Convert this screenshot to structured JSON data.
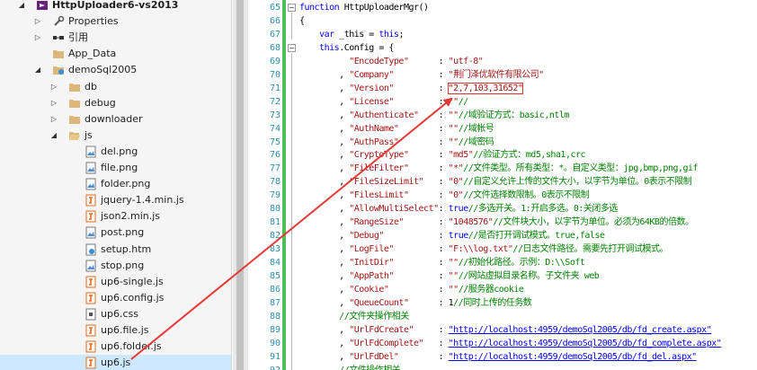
{
  "tree": [
    {
      "label": "HttpUploader6-vs2013",
      "depth": 0,
      "arrow": "expanded",
      "icon": "solution-icon",
      "bold": true
    },
    {
      "label": "Properties",
      "depth": 1,
      "arrow": "collapsed",
      "icon": "wrench-icon"
    },
    {
      "label": "引用",
      "depth": 1,
      "arrow": "collapsed",
      "icon": "references-icon"
    },
    {
      "label": "App_Data",
      "depth": 1,
      "arrow": "none",
      "icon": "folder-icon"
    },
    {
      "label": "demoSql2005",
      "depth": 1,
      "arrow": "expanded",
      "icon": "web-folder-icon"
    },
    {
      "label": "db",
      "depth": 2,
      "arrow": "collapsed",
      "icon": "folder-icon"
    },
    {
      "label": "debug",
      "depth": 2,
      "arrow": "collapsed",
      "icon": "folder-icon"
    },
    {
      "label": "downloader",
      "depth": 2,
      "arrow": "collapsed",
      "icon": "folder-icon"
    },
    {
      "label": "js",
      "depth": 2,
      "arrow": "expanded",
      "icon": "folder-open-icon"
    },
    {
      "label": "del.png",
      "depth": 3,
      "arrow": "none",
      "icon": "image-file-icon"
    },
    {
      "label": "file.png",
      "depth": 3,
      "arrow": "none",
      "icon": "image-file-icon"
    },
    {
      "label": "folder.png",
      "depth": 3,
      "arrow": "none",
      "icon": "image-file-icon"
    },
    {
      "label": "jquery-1.4.min.js",
      "depth": 3,
      "arrow": "none",
      "icon": "js-file-icon"
    },
    {
      "label": "json2.min.js",
      "depth": 3,
      "arrow": "none",
      "icon": "js-file-icon"
    },
    {
      "label": "post.png",
      "depth": 3,
      "arrow": "none",
      "icon": "image-file-icon"
    },
    {
      "label": "setup.htm",
      "depth": 3,
      "arrow": "none",
      "icon": "html-file-icon"
    },
    {
      "label": "stop.png",
      "depth": 3,
      "arrow": "none",
      "icon": "image-file-icon"
    },
    {
      "label": "up6-single.js",
      "depth": 3,
      "arrow": "none",
      "icon": "js-file-icon"
    },
    {
      "label": "up6.config.js",
      "depth": 3,
      "arrow": "none",
      "icon": "js-file-icon"
    },
    {
      "label": "up6.css",
      "depth": 3,
      "arrow": "none",
      "icon": "css-file-icon"
    },
    {
      "label": "up6.file.js",
      "depth": 3,
      "arrow": "none",
      "icon": "js-file-icon"
    },
    {
      "label": "up6.folder.js",
      "depth": 3,
      "arrow": "none",
      "icon": "js-file-icon"
    },
    {
      "label": "up6.js",
      "depth": 3,
      "arrow": "none",
      "icon": "js-file-icon",
      "selected": true
    }
  ],
  "code": [
    {
      "n": "65",
      "fold": "minus",
      "toks": [
        [
          "kw",
          "function"
        ],
        [
          "p",
          " HttpUploaderMgr()"
        ]
      ]
    },
    {
      "n": "66",
      "toks": [
        [
          "p",
          "{"
        ]
      ]
    },
    {
      "n": "67",
      "toks": [
        [
          "p",
          "    "
        ],
        [
          "kw",
          "var"
        ],
        [
          "p",
          " _this = "
        ],
        [
          "kw",
          "this"
        ],
        [
          "p",
          ";"
        ]
      ]
    },
    {
      "n": "68",
      "fold": "minus",
      "toks": [
        [
          "p",
          "    "
        ],
        [
          "kw",
          "this"
        ],
        [
          "p",
          ".Config = {"
        ]
      ]
    },
    {
      "n": "69",
      "toks": [
        [
          "p",
          "          "
        ],
        [
          "str",
          "\"EncodeType\""
        ],
        [
          "p",
          "      : "
        ],
        [
          "str",
          "\"utf-8\""
        ]
      ]
    },
    {
      "n": "70",
      "toks": [
        [
          "p",
          "        , "
        ],
        [
          "str",
          "\"Company\""
        ],
        [
          "p",
          "         : "
        ],
        [
          "str",
          "\"荆门泽优软件有限公司\""
        ]
      ]
    },
    {
      "n": "71",
      "toks": [
        [
          "p",
          "        , "
        ],
        [
          "str",
          "\"Version\""
        ],
        [
          "p",
          "         : "
        ],
        [
          "str",
          "\"2,7,103,31652\"",
          "hl"
        ]
      ]
    },
    {
      "n": "72",
      "toks": [
        [
          "p",
          "        , "
        ],
        [
          "str",
          "\"License\""
        ],
        [
          "p",
          "         : "
        ],
        [
          "str",
          "\"\""
        ],
        [
          "cmt",
          "//"
        ]
      ]
    },
    {
      "n": "73",
      "toks": [
        [
          "p",
          "        , "
        ],
        [
          "str",
          "\"Authenticate\""
        ],
        [
          "p",
          "    : "
        ],
        [
          "str",
          "\"\""
        ],
        [
          "cmt",
          "//域验证方式：basic,ntlm"
        ]
      ]
    },
    {
      "n": "74",
      "toks": [
        [
          "p",
          "        , "
        ],
        [
          "str",
          "\"AuthName\""
        ],
        [
          "p",
          "        : "
        ],
        [
          "str",
          "\"\""
        ],
        [
          "cmt",
          "//域帐号"
        ]
      ]
    },
    {
      "n": "75",
      "toks": [
        [
          "p",
          "        , "
        ],
        [
          "str",
          "\"AuthPass\""
        ],
        [
          "p",
          "        : "
        ],
        [
          "str",
          "\"\""
        ],
        [
          "cmt",
          "//域密码"
        ]
      ]
    },
    {
      "n": "76",
      "toks": [
        [
          "p",
          "        , "
        ],
        [
          "str",
          "\"CryptoType\""
        ],
        [
          "p",
          "      : "
        ],
        [
          "str",
          "\"md5\""
        ],
        [
          "cmt",
          "//验证方式：md5,sha1,crc"
        ]
      ]
    },
    {
      "n": "77",
      "toks": [
        [
          "p",
          "        , "
        ],
        [
          "str",
          "\"FileFilter\""
        ],
        [
          "p",
          "      : "
        ],
        [
          "str",
          "\"*\""
        ],
        [
          "cmt",
          "//文件类型。所有类型：*。自定义类型：jpg,bmp,png,gif"
        ]
      ]
    },
    {
      "n": "78",
      "toks": [
        [
          "p",
          "        , "
        ],
        [
          "str",
          "\"FileSizeLimit\""
        ],
        [
          "p",
          "   : "
        ],
        [
          "str",
          "\"0\""
        ],
        [
          "cmt",
          "//自定义允许上传的文件大小，以字节为单位。0表示不限制"
        ]
      ]
    },
    {
      "n": "79",
      "toks": [
        [
          "p",
          "        , "
        ],
        [
          "str",
          "\"FilesLimit\""
        ],
        [
          "p",
          "      : "
        ],
        [
          "str",
          "\"0\""
        ],
        [
          "cmt",
          "//文件选择数限制。0表示不限制"
        ]
      ]
    },
    {
      "n": "80",
      "toks": [
        [
          "p",
          "        , "
        ],
        [
          "str",
          "\"AllowMultiSelect\""
        ],
        [
          "p",
          ": "
        ],
        [
          "kw",
          "true"
        ],
        [
          "cmt",
          "//多选开关。1:开启多选。0:关闭多选"
        ]
      ]
    },
    {
      "n": "81",
      "toks": [
        [
          "p",
          "        , "
        ],
        [
          "str",
          "\"RangeSize\""
        ],
        [
          "p",
          "       : "
        ],
        [
          "str",
          "\"1048576\""
        ],
        [
          "cmt",
          "//文件块大小，以字节为单位。必须为64KB的倍数。"
        ]
      ]
    },
    {
      "n": "82",
      "toks": [
        [
          "p",
          "        , "
        ],
        [
          "str",
          "\"Debug\""
        ],
        [
          "p",
          "           : "
        ],
        [
          "kw",
          "true"
        ],
        [
          "cmt",
          "//是否打开调试模式。true,false"
        ]
      ]
    },
    {
      "n": "83",
      "toks": [
        [
          "p",
          "        , "
        ],
        [
          "str",
          "\"LogFile\""
        ],
        [
          "p",
          "         : "
        ],
        [
          "str",
          "\"F:\\\\log.txt\""
        ],
        [
          "cmt",
          "//日志文件路径。需要先打开调试模式。"
        ]
      ]
    },
    {
      "n": "84",
      "toks": [
        [
          "p",
          "        , "
        ],
        [
          "str",
          "\"InitDir\""
        ],
        [
          "p",
          "         : "
        ],
        [
          "str",
          "\"\""
        ],
        [
          "cmt",
          "//初始化路径。示例：D:\\\\Soft"
        ]
      ]
    },
    {
      "n": "85",
      "toks": [
        [
          "p",
          "        , "
        ],
        [
          "str",
          "\"AppPath\""
        ],
        [
          "p",
          "         : "
        ],
        [
          "str",
          "\"\""
        ],
        [
          "cmt",
          "//网站虚拟目录名称。子文件夹 web"
        ]
      ]
    },
    {
      "n": "86",
      "toks": [
        [
          "p",
          "        , "
        ],
        [
          "str",
          "\"Cookie\""
        ],
        [
          "p",
          "          : "
        ],
        [
          "str",
          "\"\""
        ],
        [
          "cmt",
          "//服务器cookie"
        ]
      ]
    },
    {
      "n": "87",
      "toks": [
        [
          "p",
          "        , "
        ],
        [
          "str",
          "\"QueueCount\""
        ],
        [
          "p",
          "      : 1"
        ],
        [
          "cmt",
          "//同时上传的任务数"
        ]
      ]
    },
    {
      "n": "88",
      "toks": [
        [
          "p",
          "        "
        ],
        [
          "cmt",
          "//文件夹操作相关"
        ]
      ]
    },
    {
      "n": "89",
      "toks": [
        [
          "p",
          "        , "
        ],
        [
          "str",
          "\"UrlFdCreate\""
        ],
        [
          "p",
          "     : "
        ],
        [
          "url",
          "\"http://localhost:4959/demoSql2005/db/fd_create.aspx\""
        ]
      ]
    },
    {
      "n": "90",
      "toks": [
        [
          "p",
          "        , "
        ],
        [
          "str",
          "\"UrlFdComplete\""
        ],
        [
          "p",
          "   : "
        ],
        [
          "url",
          "\"http://localhost:4959/demoSql2005/db/fd_complete.aspx\""
        ]
      ]
    },
    {
      "n": "91",
      "toks": [
        [
          "p",
          "        , "
        ],
        [
          "str",
          "\"UrlFdDel\""
        ],
        [
          "p",
          "        : "
        ],
        [
          "url",
          "\"http://localhost:4959/demoSql2005/db/fd_del.aspx\""
        ]
      ]
    },
    {
      "n": "92",
      "toks": [
        [
          "p",
          "        "
        ],
        [
          "cmt",
          "//文件操作相关"
        ]
      ]
    }
  ],
  "colors": {
    "arrow": "#e53935",
    "selection": "#cde8ff",
    "keyword": "#0000ff",
    "string": "#a31515",
    "comment": "#008000",
    "linenum": "#2b91af"
  }
}
